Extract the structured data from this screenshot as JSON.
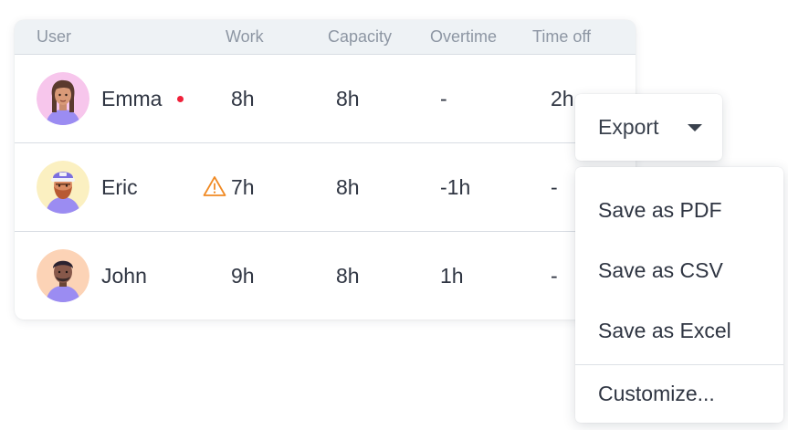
{
  "table": {
    "headers": {
      "user": "User",
      "work": "Work",
      "capacity": "Capacity",
      "overtime": "Overtime",
      "time_off": "Time off"
    },
    "rows": [
      {
        "name": "Emma",
        "work": "8h",
        "capacity": "8h",
        "overtime": "-",
        "time_off": "2h",
        "indicator": "red-dot",
        "avatar_bg": "#f7c6ec"
      },
      {
        "name": "Eric",
        "work": "7h",
        "capacity": "8h",
        "overtime": "-1h",
        "time_off": "-",
        "indicator": "warning-icon",
        "avatar_bg": "#fbf0c1"
      },
      {
        "name": "John",
        "work": "9h",
        "capacity": "8h",
        "overtime": "1h",
        "time_off": "-",
        "indicator": "",
        "avatar_bg": "#fcd3b6"
      }
    ]
  },
  "export": {
    "label": "Export",
    "icon": "caret-down-icon"
  },
  "menu": {
    "items": [
      "Save as PDF",
      "Save as CSV",
      "Save as Excel",
      "Customize..."
    ]
  },
  "colors": {
    "header_bg": "#eef2f5",
    "header_text": "#8d96a3",
    "body_text": "#2f3542",
    "alert_dot": "#f0213a",
    "warning": "#f08a24",
    "avatar_shirt": "#9b8cf2"
  }
}
